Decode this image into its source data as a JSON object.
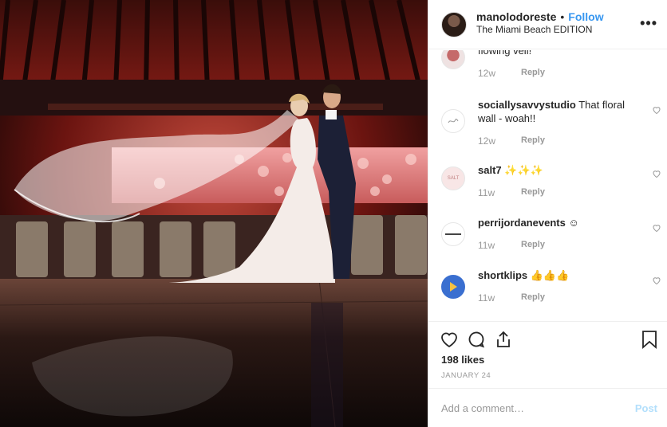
{
  "post": {
    "image_alt": "wedding couple with flowing veil",
    "header": {
      "username": "manolodoreste",
      "dot": "•",
      "follow_label": "Follow",
      "location": "The Miami Beach EDITION",
      "more_icon": "more-options-icon"
    },
    "comments": [
      {
        "username": "",
        "text": "flowing veil!",
        "time": "12w",
        "reply": "Reply",
        "avatar_text": ""
      },
      {
        "username": "sociallysavvystudio",
        "text": "That floral wall - woah!!",
        "time": "12w",
        "reply": "Reply",
        "avatar_text": ""
      },
      {
        "username": "salt7",
        "text": "✨✨✨",
        "time": "11w",
        "reply": "Reply",
        "avatar_text": "SALT"
      },
      {
        "username": "perrijordanevents",
        "text": "☺",
        "time": "11w",
        "reply": "Reply",
        "avatar_text": ""
      },
      {
        "username": "shortklips",
        "text": "👍👍👍",
        "time": "11w",
        "reply": "Reply",
        "avatar_text": ""
      }
    ],
    "likes": "198 likes",
    "date": "JANUARY 24",
    "add_comment_placeholder": "Add a comment…",
    "post_label": "Post"
  },
  "colors": {
    "link_blue": "#3897f0",
    "post_disabled": "#b2dffc",
    "muted": "#999999",
    "text": "#262626"
  }
}
